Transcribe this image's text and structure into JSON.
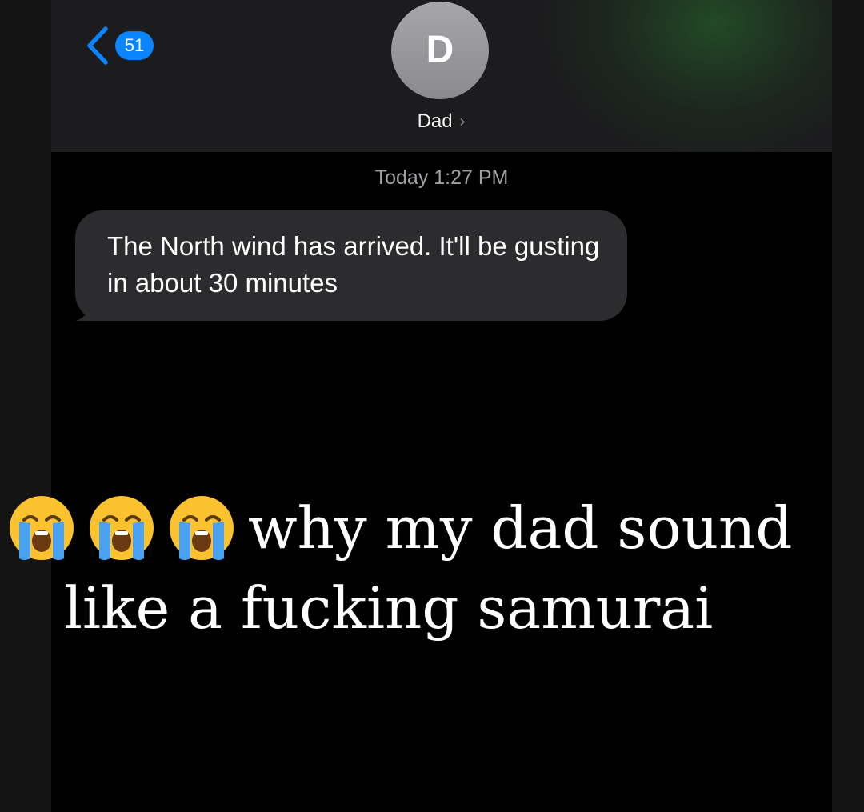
{
  "header": {
    "back_badge_count": "51",
    "avatar_initial": "D",
    "contact_name": "Dad",
    "contact_chevron": "›"
  },
  "thread": {
    "timestamp": "Today 1:27 PM",
    "messages": [
      {
        "direction": "incoming",
        "text": "The North wind has arrived. It'll be gusting in about 30 minutes"
      }
    ]
  },
  "caption": {
    "emoji": "loudly-crying-face-icon",
    "emoji_count": 3,
    "line1": "why my dad sound",
    "line2": "like a fucking samurai"
  },
  "colors": {
    "accent_blue": "#0a84ff",
    "bubble_gray": "#2c2c2e",
    "header_bg": "#1c1c1e",
    "emoji_yellow": "#f9c22e",
    "tear_blue": "#4aa3f0"
  }
}
